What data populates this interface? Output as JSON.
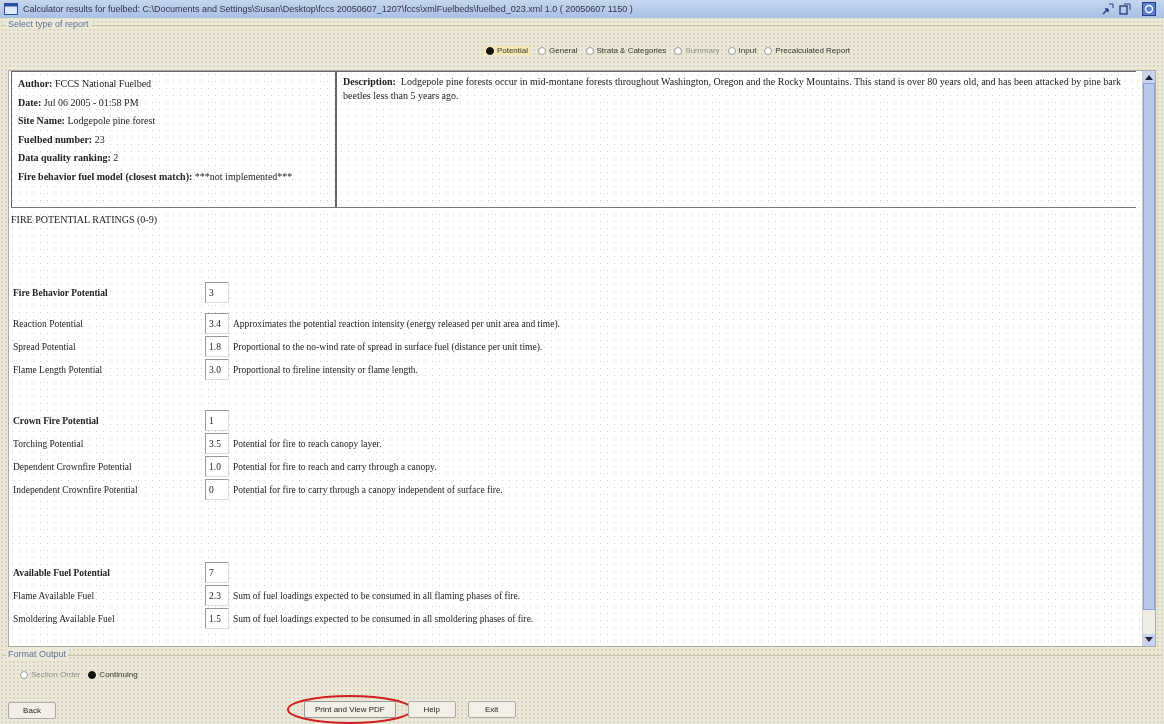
{
  "window": {
    "title": "Calculator results for fuelbed: C:\\Documents and Settings\\Susan\\Desktop\\fccs 20050607_1207\\fccs\\xmlFuelbeds\\fuelbed_023.xml 1.0 ( 20050607 1150 )"
  },
  "report_type": {
    "legend": "Select type of report",
    "options": [
      {
        "label": "Potential",
        "selected": true,
        "disabled": false
      },
      {
        "label": "General",
        "selected": false,
        "disabled": false
      },
      {
        "label": "Strata & Categories",
        "selected": false,
        "disabled": false
      },
      {
        "label": "Summary",
        "selected": false,
        "disabled": true
      },
      {
        "label": "Input",
        "selected": false,
        "disabled": false
      },
      {
        "label": "Precalculated Report",
        "selected": false,
        "disabled": false
      }
    ]
  },
  "info": {
    "fields": [
      {
        "label": "Author:",
        "value": "FCCS National Fuelbed"
      },
      {
        "label": "Date:",
        "value": "Jul 06 2005 - 01:58 PM"
      },
      {
        "label": "Site Name:",
        "value": "Lodgepole pine forest"
      },
      {
        "label": "Fuelbed number:",
        "value": "23"
      },
      {
        "label": "Data quality ranking:",
        "value": "2"
      },
      {
        "label": "Fire behavior fuel model (closest match):",
        "value": "***not implemented***"
      }
    ],
    "description_label": "Description:",
    "description": "Lodgepole pine forests occur in mid-montane forests throughout Washington, Oregon and the Rocky Mountains. This stand is over 80 years old, and has been attacked by pine bark beetles less than 5 years ago."
  },
  "ratings_heading": "FIRE POTENTIAL RATINGS (0-9)",
  "sections": [
    {
      "name": "Fire Behavior Potential",
      "value": "3",
      "items": [
        {
          "name": "Reaction Potential",
          "value": "3.4",
          "note": "Approximates the potential reaction intensity (energy released per unit area and time)."
        },
        {
          "name": "Spread Potential",
          "value": "1.8",
          "note": "Proportional to the no-wind rate of spread in surface fuel (distance per unit time)."
        },
        {
          "name": "Flame Length Potential",
          "value": "3.0",
          "note": "Proportional to fireline intensity or flame length."
        }
      ]
    },
    {
      "name": "Crown Fire Potential",
      "value": "1",
      "items": [
        {
          "name": "Torching Potential",
          "value": "3.5",
          "note": "Potential for fire to reach canopy layer."
        },
        {
          "name": "Dependent Crownfire Potential",
          "value": "1.0",
          "note": "Potential for fire to reach and carry through a canopy."
        },
        {
          "name": "Independent Crownfire Potential",
          "value": "0",
          "note": "Potential for fire to carry through a canopy independent of surface fire."
        }
      ]
    },
    {
      "name": "Available Fuel Potential",
      "value": "7",
      "items": [
        {
          "name": "Flame Available Fuel",
          "value": "2.3",
          "note": "Sum of fuel loadings expected to be consumed in all flaming phases of fire."
        },
        {
          "name": "Smoldering Available Fuel",
          "value": "1.5",
          "note": "Sum of fuel loadings expected to be consumed in all smoldering phases of fire."
        }
      ]
    }
  ],
  "format_output": {
    "legend": "Format Output",
    "options": [
      {
        "label": "Section Order",
        "selected": false,
        "disabled": true
      },
      {
        "label": "Continuing",
        "selected": true,
        "disabled": false
      }
    ]
  },
  "buttons": [
    {
      "label": "Back",
      "highlighted": false
    },
    {
      "label": "Print and View PDF",
      "highlighted": true
    },
    {
      "label": "Help",
      "highlighted": false
    },
    {
      "label": "Exit",
      "highlighted": false
    }
  ]
}
